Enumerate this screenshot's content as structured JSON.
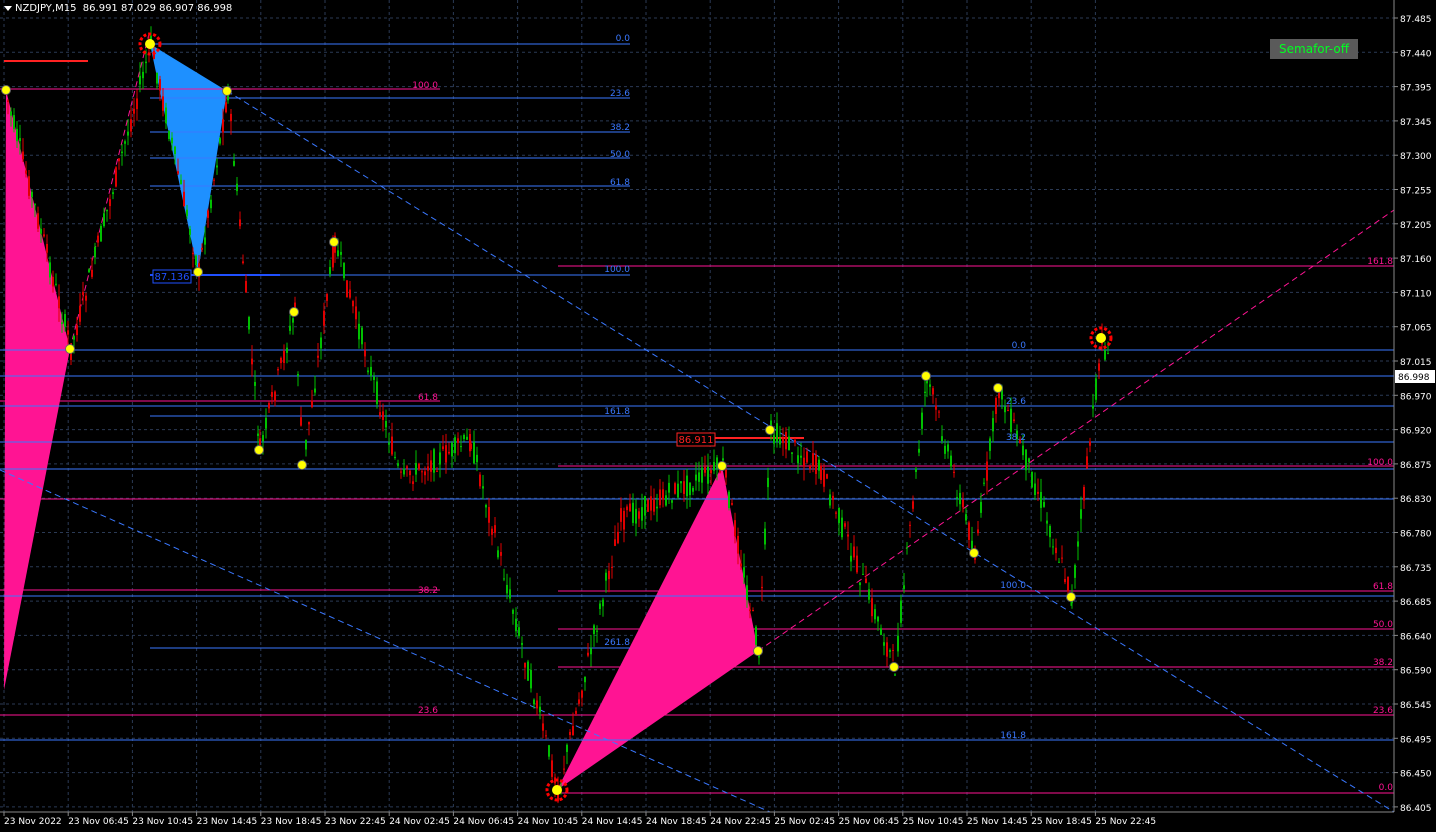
{
  "header": {
    "symbol": "NZDJPY,M15",
    "ohlc": "86.991 87.029 86.907 86.998"
  },
  "semafor_button": {
    "label": "Semafor-off"
  },
  "price_axis": {
    "ticks": [
      "87.485",
      "87.440",
      "87.395",
      "87.345",
      "87.300",
      "87.255",
      "87.205",
      "87.160",
      "87.110",
      "87.065",
      "87.015",
      "86.970",
      "86.920",
      "86.875",
      "86.830",
      "86.780",
      "86.735",
      "86.685",
      "86.640",
      "86.590",
      "86.545",
      "86.495",
      "86.450",
      "86.405"
    ],
    "current_price": "86.998"
  },
  "time_axis": {
    "ticks": [
      "23 Nov 2022",
      "23 Nov 06:45",
      "23 Nov 10:45",
      "23 Nov 14:45",
      "23 Nov 18:45",
      "23 Nov 22:45",
      "24 Nov 02:45",
      "24 Nov 06:45",
      "24 Nov 10:45",
      "24 Nov 14:45",
      "24 Nov 18:45",
      "24 Nov 22:45",
      "25 Nov 02:45",
      "25 Nov 06:45",
      "25 Nov 10:45",
      "25 Nov 14:45",
      "25 Nov 18:45",
      "25 Nov 22:45"
    ]
  },
  "colors": {
    "background": "#000000",
    "grid": "#2b3a55",
    "bull": "#00c000",
    "bear": "#e00000",
    "fib_blue": "#3a78ff",
    "fib_pink": "#ff1493",
    "pattern_fill": "#ff1493",
    "triangle_fill": "#1e90ff",
    "semafor_dot": "#ffff00",
    "semafor_big": "#ff0000"
  },
  "fib_labels_left_blue": [
    "0.0",
    "23.6",
    "38.2",
    "50.0",
    "61.8",
    "100.0",
    "161.8",
    "261.8"
  ],
  "fib_labels_left_pink": [
    "100.0",
    "61.8",
    "38.2",
    "23.6"
  ],
  "fib_labels_right_blue": [
    "0.0",
    "23.6",
    "38.2",
    "100.0",
    "161.8"
  ],
  "fib_labels_right_pink": [
    "161.8",
    "100.0",
    "61.8",
    "50.0",
    "38.2",
    "23.6",
    "0.0"
  ],
  "price_tags": [
    "87.136",
    "86.911"
  ]
}
